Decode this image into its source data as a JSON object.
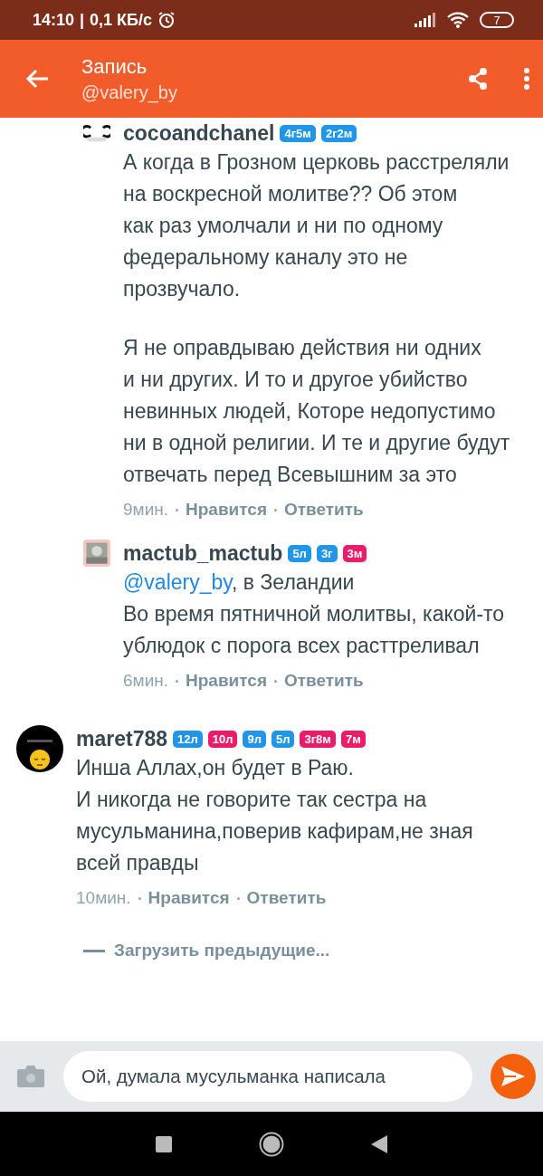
{
  "status_bar": {
    "time": "14:10",
    "separator": "|",
    "speed": "0,1 КБ/с",
    "battery": "7"
  },
  "header": {
    "title": "Запись",
    "subtitle": "@valery_by"
  },
  "comments": [
    {
      "kind": "reply",
      "username": "cocoandchanel",
      "badges": [
        {
          "label": "4г5м",
          "color": "#2196e8"
        },
        {
          "label": "2г2м",
          "color": "#2196e8"
        }
      ],
      "paragraphs": [
        "А когда в Грозном церковь расстреляли\nна воскресной молитве?? Об этом\nкак раз умолчали и ни по одному\nфедеральному каналу это не\nпрозвучало.",
        "Я не оправдываю действия ни одних\nи ни других. И то и другое убийство\nневинных людей, Которе недопустимо\nни в одной религии. И те и другие будут\nотвечать перед Всевышним за это"
      ],
      "time": "9мин.",
      "like": "Нравится",
      "reply": "Ответить"
    },
    {
      "kind": "reply",
      "username": "mactub_mactub",
      "badges": [
        {
          "label": "5л",
          "color": "#2196e8"
        },
        {
          "label": "3г",
          "color": "#2196e8"
        },
        {
          "label": "3м",
          "color": "#ec1c68"
        }
      ],
      "mention": "@valery_by",
      "paragraphs": [
        ", в Зеландии\nВо время пятничной молитвы, какой-то\nублюдок с порога всех расттреливал"
      ],
      "time": "6мин.",
      "like": "Нравится",
      "reply": "Ответить"
    },
    {
      "kind": "comment",
      "username": "maret788",
      "badges": [
        {
          "label": "12л",
          "color": "#2196e8"
        },
        {
          "label": "10л",
          "color": "#ec1c68"
        },
        {
          "label": "9л",
          "color": "#2196e8"
        },
        {
          "label": "5л",
          "color": "#2196e8"
        },
        {
          "label": "3г8м",
          "color": "#ec1c68"
        },
        {
          "label": "7м",
          "color": "#ec1c68"
        }
      ],
      "paragraphs": [
        "Инша Аллах,он будет в Раю.\nИ никогда не говорите так сестра на\nмусульманина,поверив кафирам,не зная\nвсей правды"
      ],
      "time": "10мин.",
      "like": "Нравится",
      "reply": "Ответить"
    }
  ],
  "load_more": "Загрузить предыдущие...",
  "composer": {
    "value": "Ой, думала мусульманка написала"
  }
}
